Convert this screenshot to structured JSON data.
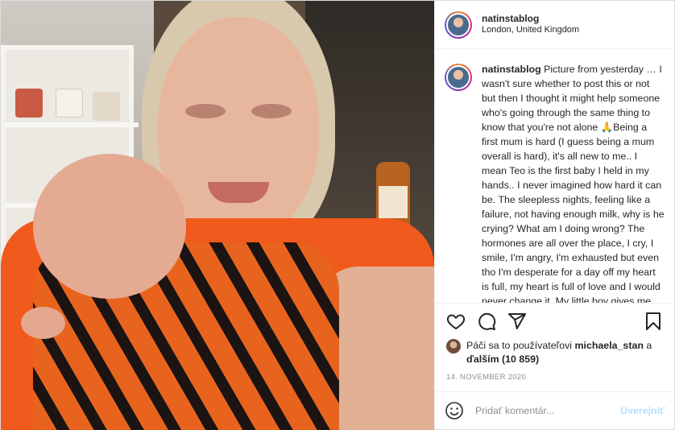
{
  "post": {
    "author": {
      "username": "natinstablog",
      "location": "London, United Kingdom"
    },
    "caption": {
      "username": "natinstablog",
      "text": "Picture from yesterday … I wasn't sure whether to post this or not but then I thought it might help someone who's going through the same thing to know that you're not alone 🙏Being a first mum is hard (I guess being a mum overall is hard), it's all new to me.. I mean Teo is the first baby I held in my hands.. I never imagined how hard it can be. The sleepless nights, feeling like a failure, not having enough milk, why is he crying? What am I doing wrong? The hormones are all over the place, I cry, I smile, I'm angry, I'm exhausted but even tho I'm desperate for a day off my heart is full, my heart is full of love and I would never change it. My little boy gives me strength every time I"
    },
    "likes": {
      "prefix": "Páči sa to používateľovi",
      "liker": "michaela_stan",
      "connector": "a",
      "others": "ďalším (10 859)"
    },
    "date": "14. NOVEMBER 2020",
    "comment_box": {
      "placeholder": "Pridať komentár...",
      "post_label": "Uverejniť"
    },
    "icons": {
      "like": "heart-icon",
      "comment": "comment-bubble-icon",
      "share": "paper-plane-icon",
      "save": "bookmark-icon",
      "emoji": "smiley-icon"
    },
    "colors": {
      "post_button": "#b2dffc",
      "muted": "#8e8e8e",
      "text": "#262626"
    }
  }
}
